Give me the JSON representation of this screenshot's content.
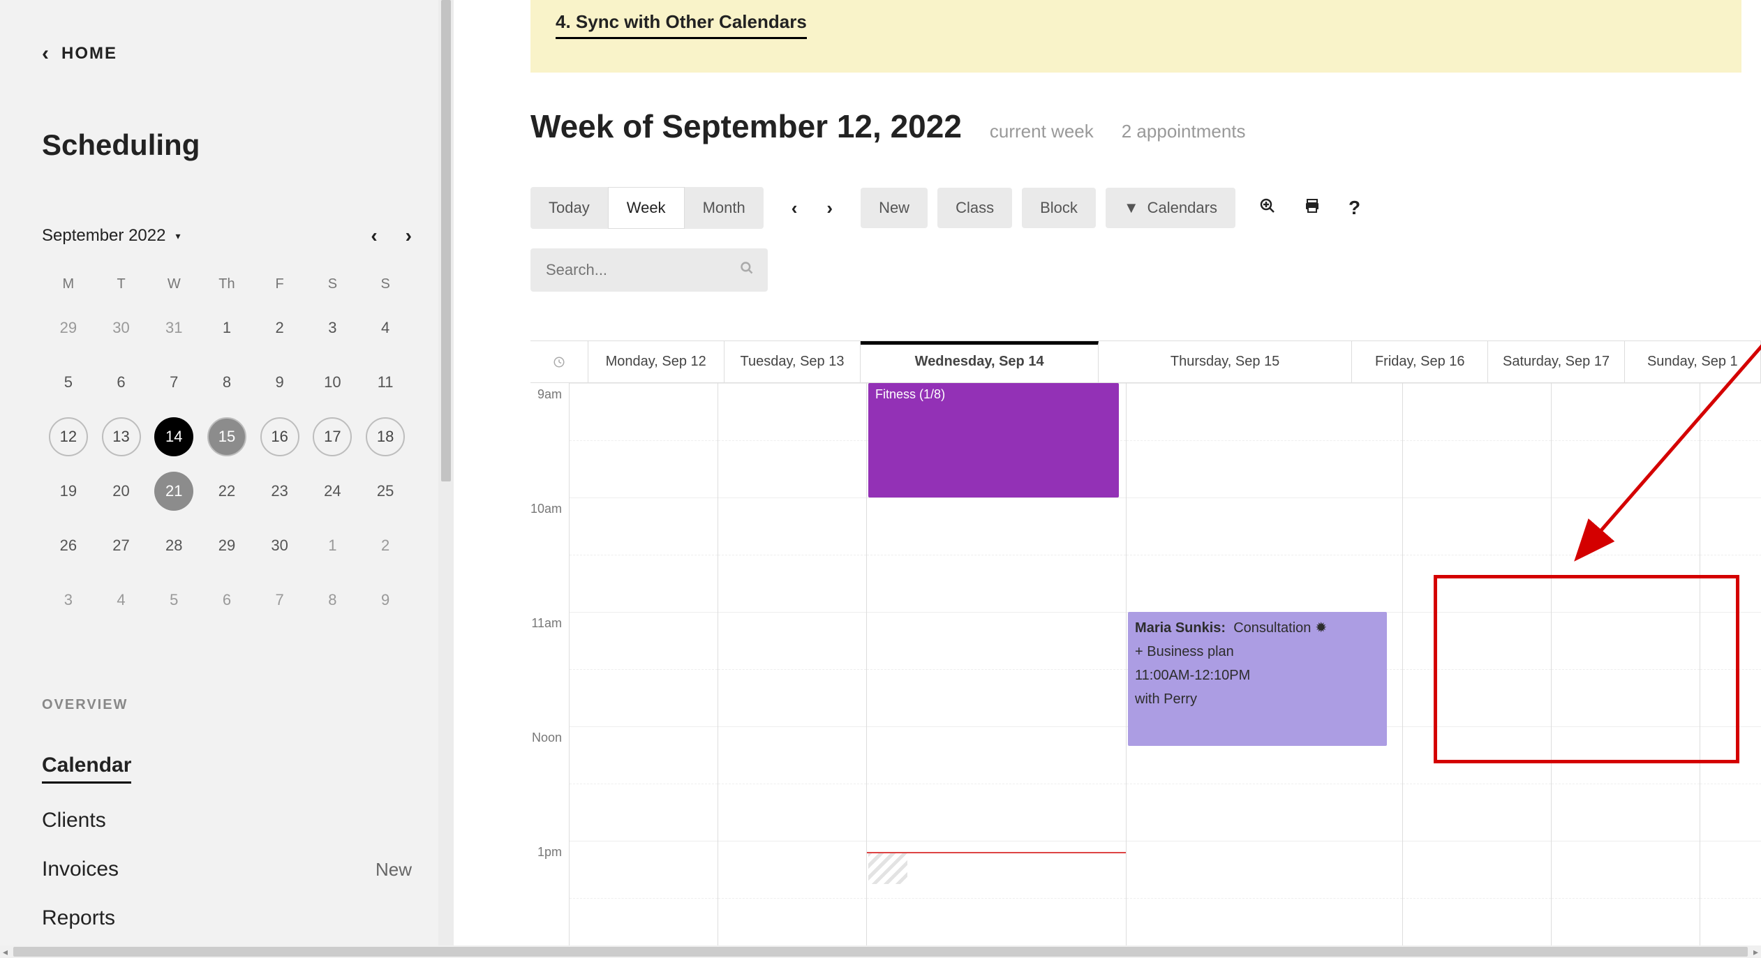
{
  "sidebar": {
    "home_label": "HOME",
    "section_title": "Scheduling",
    "month_label": "September 2022",
    "dow": [
      "M",
      "T",
      "W",
      "Th",
      "F",
      "S",
      "S"
    ],
    "weeks": [
      [
        {
          "n": "29",
          "cls": "out"
        },
        {
          "n": "30",
          "cls": "out"
        },
        {
          "n": "31",
          "cls": "out"
        },
        {
          "n": "1"
        },
        {
          "n": "2"
        },
        {
          "n": "3"
        },
        {
          "n": "4"
        }
      ],
      [
        {
          "n": "5"
        },
        {
          "n": "6"
        },
        {
          "n": "7"
        },
        {
          "n": "8"
        },
        {
          "n": "9"
        },
        {
          "n": "10"
        },
        {
          "n": "11"
        }
      ],
      [
        {
          "n": "12",
          "cls": "ring"
        },
        {
          "n": "13",
          "cls": "ring"
        },
        {
          "n": "14",
          "cls": "selected"
        },
        {
          "n": "15",
          "cls": "grayfill"
        },
        {
          "n": "16",
          "cls": "ring"
        },
        {
          "n": "17",
          "cls": "ring"
        },
        {
          "n": "18",
          "cls": "ring"
        }
      ],
      [
        {
          "n": "19"
        },
        {
          "n": "20"
        },
        {
          "n": "21",
          "cls": "grayfill2"
        },
        {
          "n": "22"
        },
        {
          "n": "23"
        },
        {
          "n": "24"
        },
        {
          "n": "25"
        }
      ],
      [
        {
          "n": "26"
        },
        {
          "n": "27"
        },
        {
          "n": "28"
        },
        {
          "n": "29"
        },
        {
          "n": "30"
        },
        {
          "n": "1",
          "cls": "out"
        },
        {
          "n": "2",
          "cls": "out"
        }
      ],
      [
        {
          "n": "3",
          "cls": "out"
        },
        {
          "n": "4",
          "cls": "out"
        },
        {
          "n": "5",
          "cls": "out"
        },
        {
          "n": "6",
          "cls": "out"
        },
        {
          "n": "7",
          "cls": "out"
        },
        {
          "n": "8",
          "cls": "out"
        },
        {
          "n": "9",
          "cls": "out"
        }
      ]
    ],
    "overview_label": "OVERVIEW",
    "nav": [
      {
        "text": "Calendar",
        "active": true
      },
      {
        "text": "Clients"
      },
      {
        "text": "Invoices",
        "badge": "New"
      },
      {
        "text": "Reports"
      }
    ]
  },
  "banner": {
    "step": "4. Sync with Other Calendars"
  },
  "header": {
    "title": "Week of September 12, 2022",
    "meta1": "current week",
    "meta2": "2 appointments"
  },
  "toolbar": {
    "today": "Today",
    "week": "Week",
    "month": "Month",
    "new": "New",
    "class": "Class",
    "block": "Block",
    "calendars": "Calendars",
    "search_placeholder": "Search..."
  },
  "calendar": {
    "days": [
      {
        "label": "Monday, Sep 12",
        "cls": "mon"
      },
      {
        "label": "Tuesday, Sep 13",
        "cls": "tue"
      },
      {
        "label": "Wednesday, Sep 14",
        "cls": "wed today"
      },
      {
        "label": "Thursday, Sep 15",
        "cls": "thu"
      },
      {
        "label": "Friday, Sep 16",
        "cls": "fri"
      },
      {
        "label": "Saturday, Sep 17",
        "cls": "sat"
      },
      {
        "label": "Sunday, Sep 1",
        "cls": "sun"
      }
    ],
    "times": [
      "9am",
      "10am",
      "11am",
      "Noon",
      "1pm"
    ],
    "fitness": {
      "label": "Fitness (1/8)"
    },
    "appt": {
      "name": "Maria Sunkis:",
      "type": "Consultation",
      "addon": "+ Business plan",
      "time": "11:00AM-12:10PM",
      "with": "with Perry"
    }
  }
}
